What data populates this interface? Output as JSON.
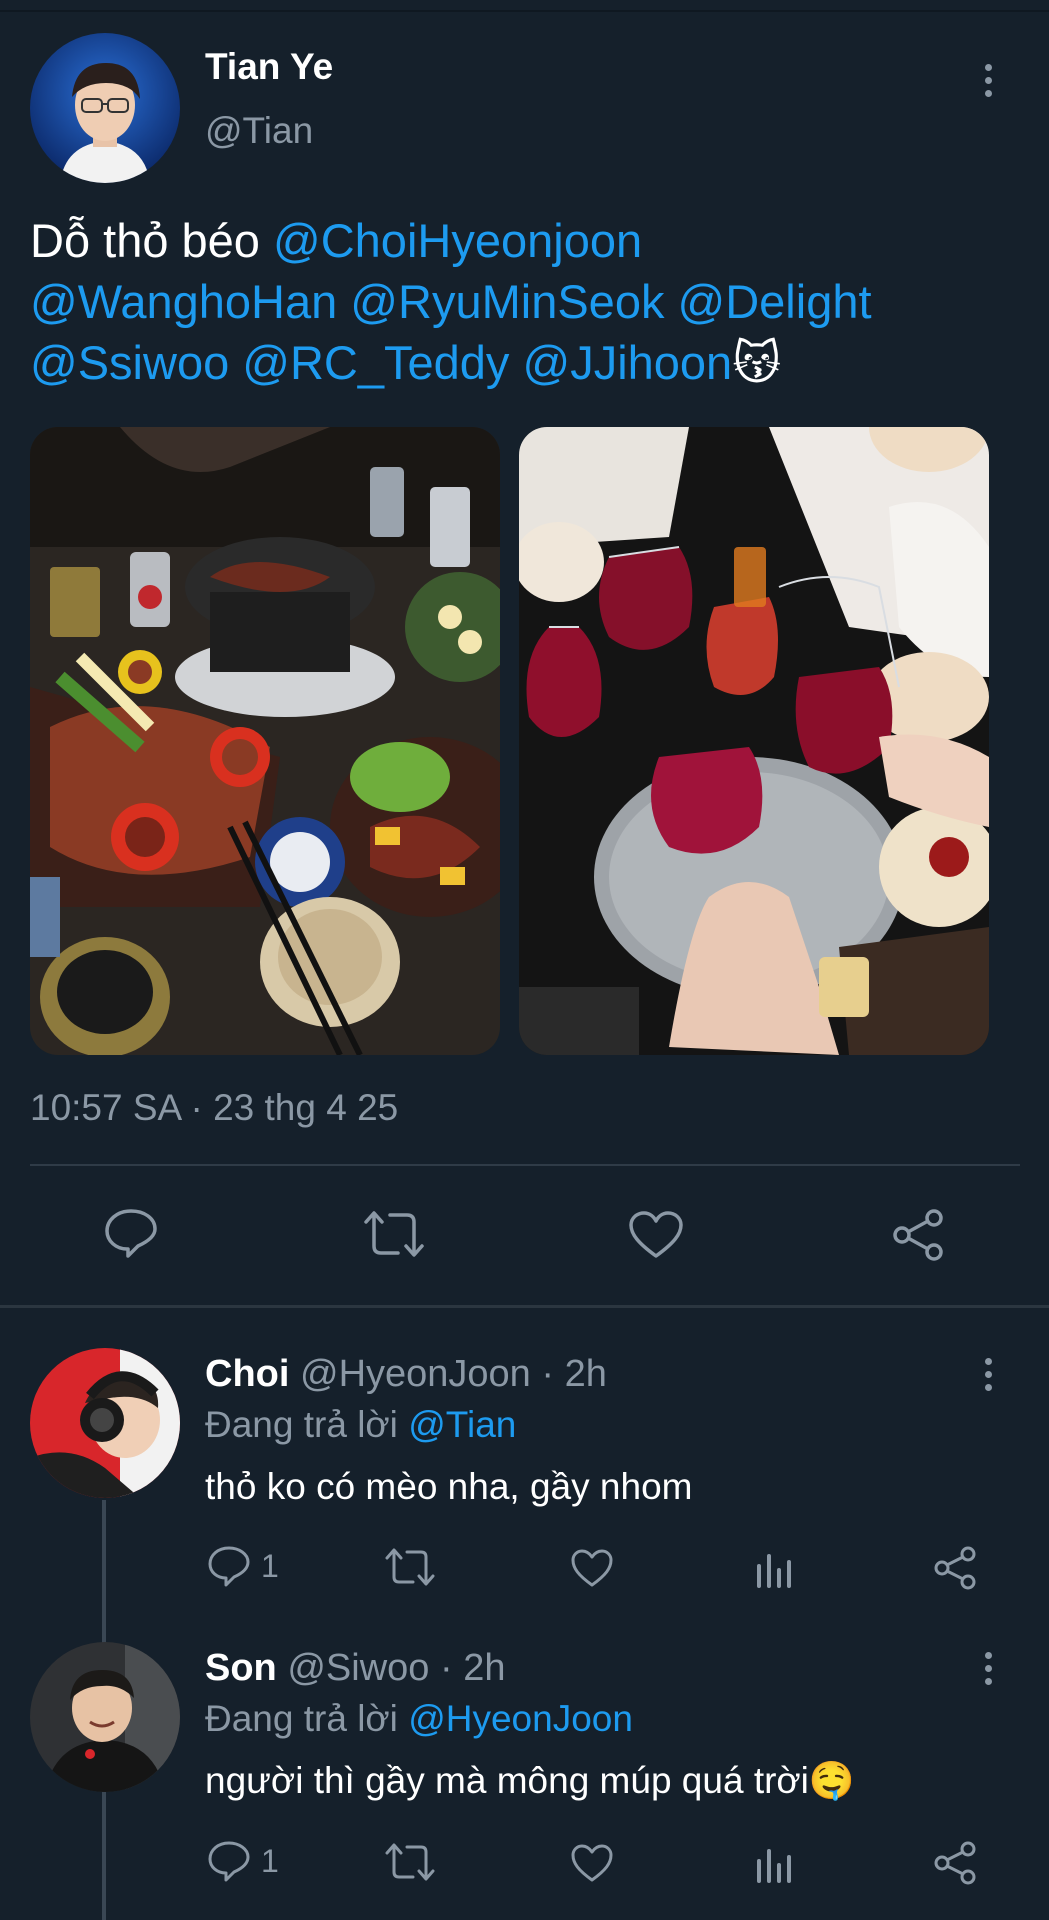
{
  "tweet": {
    "author_name": "Tian Ye",
    "author_handle": "@Tian",
    "text_prefix": "Dỗ thỏ béo ",
    "mentions_line1": "@ChoiHyeonjoon",
    "mentions_line2": "@WanghoHan @RyuMinSeok @Delight",
    "mentions_line3": "@Ssiwoo @RC_Teddy @JJihoon",
    "emoji": "😽",
    "timestamp": "10:57 SA · 23 thg 4 25",
    "photos": [
      "korean-bbq-table-photo",
      "red-wine-toast-photo"
    ],
    "actions": [
      "reply-icon",
      "retweet-icon",
      "like-icon",
      "share-icon"
    ]
  },
  "replies": [
    {
      "name": "Choi",
      "handle": "@HyeonJoon",
      "time": " · 2h",
      "replying_prefix": "Đang trả lời ",
      "replying_to": "@Tian",
      "text": "thỏ ko có mèo nha, gầy nhom",
      "reply_count": "1",
      "emoji": ""
    },
    {
      "name": "Son",
      "handle": "@Siwoo",
      "time": " · 2h",
      "replying_prefix": "Đang trả lời ",
      "replying_to": "@HyeonJoon",
      "text": "người thì gầy mà mông múp quá trời",
      "reply_count": "1",
      "emoji": "🤤"
    }
  ],
  "colors": {
    "background": "#15202b",
    "accent": "#1d9bf0",
    "muted": "#8b98a5",
    "divider": "#2f3b47"
  }
}
